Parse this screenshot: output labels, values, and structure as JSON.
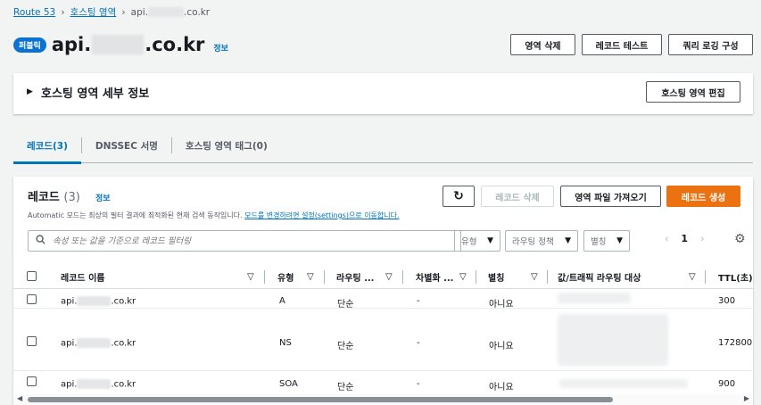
{
  "breadcrumb": {
    "root": "Route 53",
    "section": "호스팅 영역",
    "current_prefix": "api.",
    "current_suffix": ".co.kr"
  },
  "header": {
    "badge": "퍼블릭",
    "title_prefix": "api.",
    "title_suffix": ".co.kr",
    "info": "정보",
    "buttons": {
      "delete_zone": "영역 삭제",
      "test_record": "레코드 테스트",
      "query_logging": "쿼리 로깅 구성"
    }
  },
  "details": {
    "title": "호스팅 영역 세부 정보",
    "edit_button": "호스팅 영역 편집"
  },
  "tabs": [
    "레코드(3)",
    "DNSSEC 서명",
    "호스팅 영역 태그(0)"
  ],
  "records": {
    "title": "레코드",
    "count": "(3)",
    "info": "정보",
    "description": "Automatic 모드는 최상의 필터 결과에 최적화된 현재 검색 동작입니다.",
    "description_link": "모드를 변경하려면 설정(settings)으로 이동합니다.",
    "buttons": {
      "refresh": "↻",
      "delete": "레코드 삭제",
      "import": "영역 파일 가져오기",
      "create": "레코드 생성"
    },
    "search_placeholder": "속성 또는 값을 기준으로 레코드 필터링",
    "filters": {
      "type": "유형",
      "routing": "라우팅 정책",
      "alias": "별칭"
    },
    "page": "1",
    "columns": [
      "레코드 이름",
      "유형",
      "라우팅 ...",
      "차별화 ...",
      "별칭",
      "값/트래픽 라우팅 대상",
      "TTL(초)"
    ],
    "rows": [
      {
        "name_prefix": "api.",
        "name_suffix": ".co.kr",
        "type": "A",
        "routing": "단순",
        "diff": "-",
        "alias": "아니요",
        "ttl": "300"
      },
      {
        "name_prefix": "api.",
        "name_suffix": ".co.kr",
        "type": "NS",
        "routing": "단순",
        "diff": "-",
        "alias": "아니요",
        "ttl": "172800"
      },
      {
        "name_prefix": "api.",
        "name_suffix": ".co.kr",
        "type": "SOA",
        "routing": "단순",
        "diff": "-",
        "alias": "아니요",
        "ttl": "900"
      }
    ]
  },
  "icons": {
    "breadcrumb_sep": "chevron-right-icon",
    "search": "search-icon",
    "settings": "gear-icon",
    "expand": "caret-right-icon"
  }
}
